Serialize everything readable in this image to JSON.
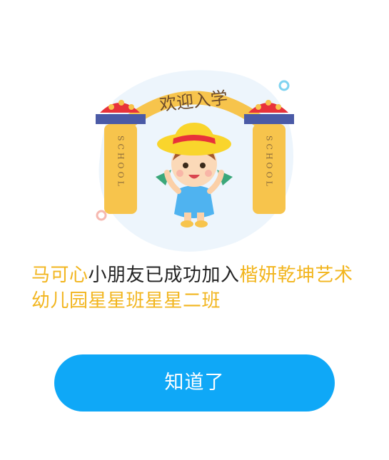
{
  "dialog": {
    "illustration": {
      "arch_text": "欢迎入学",
      "pillar_left_text": "SCHOOL",
      "pillar_right_text": "SCHOOL"
    },
    "message": {
      "child_name": "马可心",
      "middle_text": "小朋友已成功加入",
      "class_name": "楷妍乾坤艺术幼儿园星星班星星二班"
    },
    "confirm_label": "知道了"
  },
  "colors": {
    "accent": "#f2b51d",
    "button": "#0fa8f7",
    "text": "#222222"
  }
}
